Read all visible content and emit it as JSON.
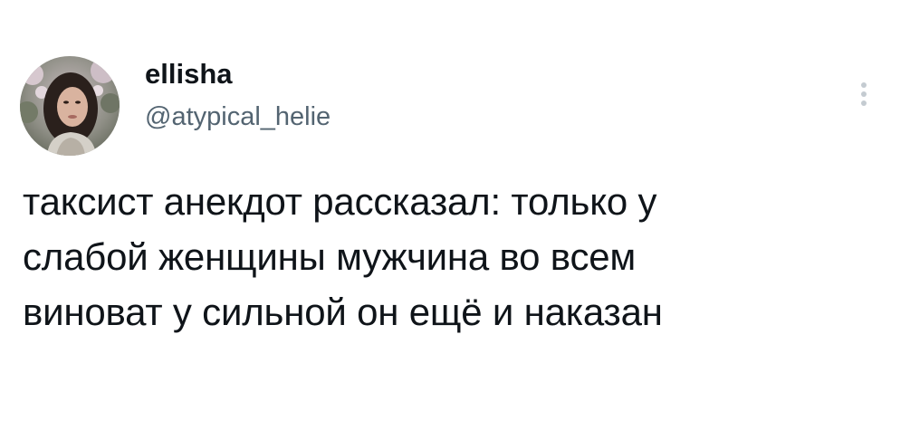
{
  "author": {
    "display_name": "ellisha",
    "handle": "@atypical_helie",
    "avatar_icon": "profile-photo"
  },
  "tweet": {
    "text": "таксист анекдот рассказал: только у\nслабой женщины мужчина во всем\nвиноват у сильной он ещё и наказан"
  },
  "actions": {
    "more_icon": "more-vertical-icon"
  },
  "colors": {
    "text_primary": "#0f1419",
    "text_secondary": "#536471",
    "background": "#ffffff"
  }
}
